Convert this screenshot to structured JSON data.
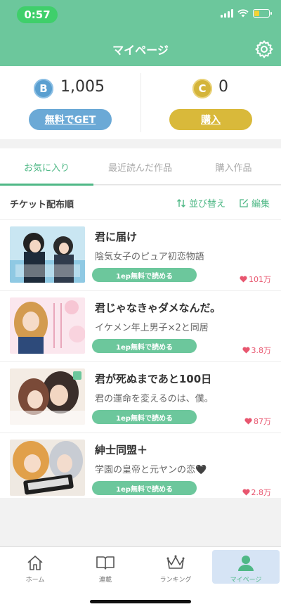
{
  "status_bar": {
    "time": "0:57",
    "battery_level": 0.35
  },
  "header": {
    "title": "マイページ"
  },
  "points": {
    "bonus": {
      "icon_letter": "B",
      "amount": "1,005",
      "button_label": "無料でGET"
    },
    "coin": {
      "icon_letter": "C",
      "amount": "0",
      "button_label": "購入"
    }
  },
  "tabs": [
    {
      "label": "お気に入り",
      "active": true
    },
    {
      "label": "最近読んだ作品",
      "active": false
    },
    {
      "label": "購入作品",
      "active": false
    }
  ],
  "list": {
    "sort_label": "チケット配布順",
    "sort_button": "並び替え",
    "edit_button": "編集",
    "items": [
      {
        "title": "君に届け",
        "subtitle": "陰気女子のピュア初恋物語",
        "badge": "1ep無料で読める",
        "likes": "101万"
      },
      {
        "title": "君じゃなきゃダメなんだ。",
        "subtitle": "イケメン年上男子×2と同居",
        "badge": "1ep無料で読める",
        "likes": "3.8万"
      },
      {
        "title": "君が死ぬまであと100日",
        "subtitle": "君の運命を変えるのは、僕。",
        "badge": "1ep無料で読める",
        "likes": "87万"
      },
      {
        "title": "紳士同盟＋",
        "subtitle": "学園の皇帝と元ヤンの恋🖤",
        "badge": "1ep無料で読める",
        "likes": "2.8万"
      }
    ]
  },
  "tabbar": [
    {
      "label": "ホーム",
      "icon": "home-icon"
    },
    {
      "label": "連載",
      "icon": "book-icon"
    },
    {
      "label": "ランキング",
      "icon": "crown-icon"
    },
    {
      "label": "マイページ",
      "icon": "person-icon",
      "active": true
    }
  ],
  "colors": {
    "brand_green": "#6cc79c",
    "bonus_blue": "#6ba9d6",
    "coin_gold": "#d9b93a",
    "heart_pink": "#e8566f"
  }
}
